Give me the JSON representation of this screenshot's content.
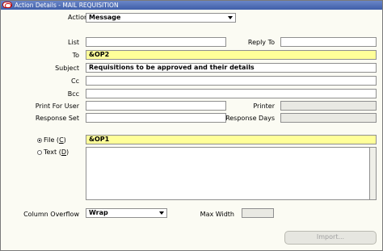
{
  "window": {
    "title": "Action Details - MAIL REQUISITION"
  },
  "form": {
    "action_type": {
      "label": "Action Type",
      "value": "Message"
    },
    "list": {
      "label": "List",
      "value": ""
    },
    "reply_to": {
      "label": "Reply To",
      "value": ""
    },
    "to": {
      "label": "To",
      "value": "&OP2"
    },
    "subject": {
      "label": "Subject",
      "value": "Requisitions to be approved and their details"
    },
    "cc": {
      "label": "Cc",
      "value": ""
    },
    "bcc": {
      "label": "Bcc",
      "value": ""
    },
    "print_for_user": {
      "label": "Print For User",
      "value": ""
    },
    "printer": {
      "label": "Printer",
      "value": ""
    },
    "response_set": {
      "label": "Response Set",
      "value": ""
    },
    "response_days": {
      "label": "Response Days",
      "value": ""
    },
    "file": {
      "label": "File (",
      "mnemonic": "C",
      "suffix": ")",
      "value": "&OP1",
      "selected": true
    },
    "text": {
      "label": "Text (",
      "mnemonic": "D",
      "suffix": ")",
      "value": "",
      "selected": false
    },
    "column_overflow": {
      "label": "Column Overflow",
      "value": "Wrap"
    },
    "max_width": {
      "label": "Max Width",
      "value": ""
    }
  },
  "buttons": {
    "import": "Import..."
  },
  "colors": {
    "required_field": "#ffff99",
    "title_bar": "#3f5ea8"
  }
}
